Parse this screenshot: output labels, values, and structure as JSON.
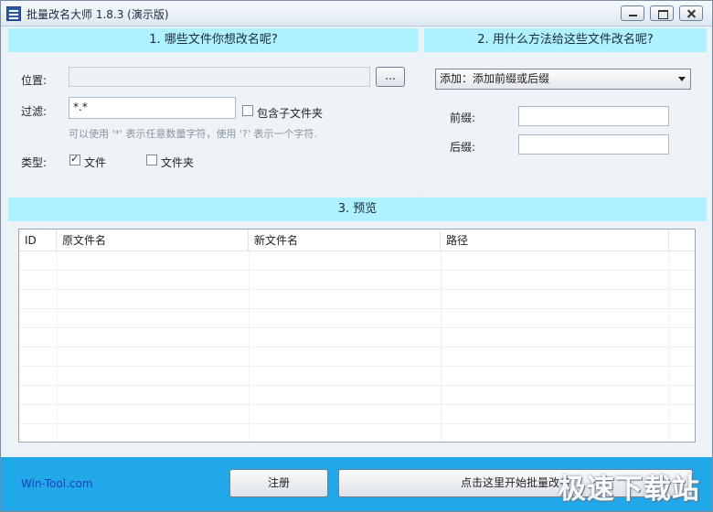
{
  "window": {
    "title": "批量改名大师 1.8.3 (演示版)"
  },
  "panel1": {
    "header": "1. 哪些文件你想改名呢?",
    "location_label": "位置:",
    "location_value": "",
    "browse_label": "...",
    "filter_label": "过滤:",
    "filter_value": "*.*",
    "include_subfolders_label": "包含子文件夹",
    "hint": "可以使用 '*' 表示任意数量字符，使用 '?' 表示一个字符.",
    "type_label": "类型:",
    "type_file_label": "文件",
    "type_folder_label": "文件夹"
  },
  "panel2": {
    "header": "2. 用什么方法给这些文件改名呢?",
    "method_selected": "添加：添加前缀或后缀",
    "prefix_label": "前缀:",
    "prefix_value": "",
    "suffix_label": "后缀:",
    "suffix_value": ""
  },
  "panel3": {
    "header": "3. 预览",
    "columns": [
      "ID",
      "原文件名",
      "新文件名",
      "路径"
    ]
  },
  "footer": {
    "brand": "Win-Tool.com",
    "register_label": "注册",
    "start_label": "点击这里开始批量改名",
    "watermark": "极速下载站"
  },
  "icons": {
    "app": "app-icon",
    "minimize": "minimize-icon",
    "maximize": "maximize-icon",
    "close": "close-icon",
    "dropdown": "chevron-down-icon"
  },
  "colors": {
    "panel_header": "#aef1ff",
    "footer": "#21a8e8",
    "brand": "#1b3fbe"
  }
}
